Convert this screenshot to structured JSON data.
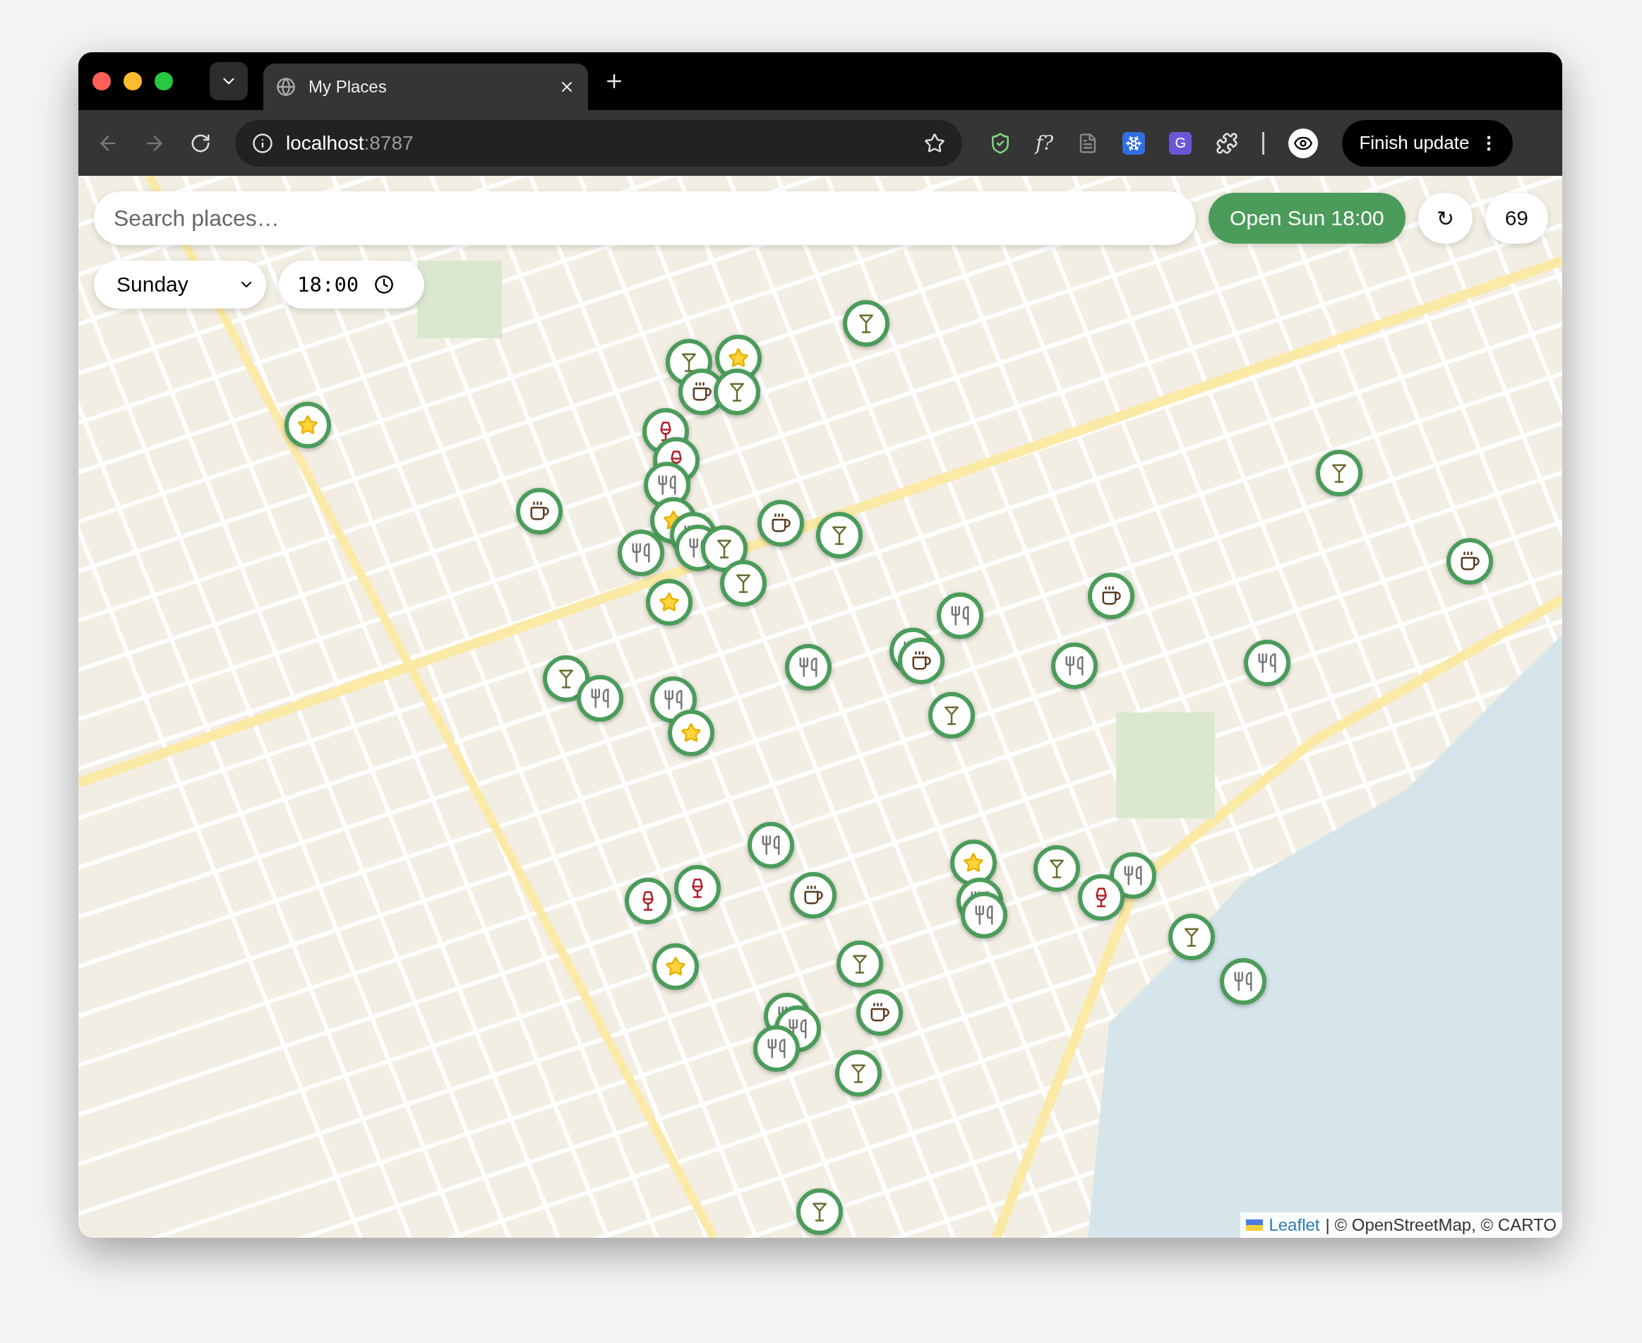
{
  "browser": {
    "tab": {
      "title": "My Places"
    },
    "address": {
      "host": "localhost",
      "port": ":8787"
    },
    "extensions": [
      {
        "kind": "shield"
      },
      {
        "kind": "formula",
        "label": "f?"
      },
      {
        "kind": "document"
      },
      {
        "kind": "snowflake"
      },
      {
        "kind": "letter",
        "label": "G"
      },
      {
        "kind": "puzzle"
      }
    ],
    "update_button": "Finish update"
  },
  "controls": {
    "search": {
      "placeholder": "Search places…"
    },
    "open_filter": "Open Sun 18:00",
    "refresh": "↻",
    "count": "69",
    "day": "Sunday",
    "time": "18:00"
  },
  "markers": [
    {
      "kind": "cocktail"
    },
    {
      "kind": "star"
    },
    {
      "kind": "cocktail"
    },
    {
      "kind": "star"
    },
    {
      "kind": "coffee"
    },
    {
      "kind": "cocktail"
    },
    {
      "kind": "wine"
    },
    {
      "kind": "wine"
    },
    {
      "kind": "dining"
    },
    {
      "kind": "star"
    },
    {
      "kind": "dining"
    },
    {
      "kind": "dining"
    },
    {
      "kind": "dining"
    },
    {
      "kind": "cocktail"
    },
    {
      "kind": "cocktail"
    },
    {
      "kind": "star"
    },
    {
      "kind": "coffee"
    },
    {
      "kind": "coffee"
    },
    {
      "kind": "cocktail"
    },
    {
      "kind": "cocktail"
    },
    {
      "kind": "coffee"
    },
    {
      "kind": "coffee"
    },
    {
      "kind": "dining"
    },
    {
      "kind": "dining"
    },
    {
      "kind": "coffee"
    },
    {
      "kind": "dining"
    },
    {
      "kind": "dining"
    },
    {
      "kind": "dining"
    },
    {
      "kind": "cocktail"
    },
    {
      "kind": "cocktail"
    },
    {
      "kind": "dining"
    },
    {
      "kind": "dining"
    },
    {
      "kind": "star"
    },
    {
      "kind": "dining"
    },
    {
      "kind": "star"
    },
    {
      "kind": "cocktail"
    },
    {
      "kind": "dining"
    },
    {
      "kind": "wine"
    },
    {
      "kind": "dining"
    },
    {
      "kind": "dining"
    },
    {
      "kind": "wine"
    },
    {
      "kind": "wine"
    },
    {
      "kind": "coffee"
    },
    {
      "kind": "cocktail"
    },
    {
      "kind": "cocktail"
    },
    {
      "kind": "star"
    },
    {
      "kind": "dining"
    },
    {
      "kind": "coffee"
    },
    {
      "kind": "dining"
    },
    {
      "kind": "dining"
    },
    {
      "kind": "dining"
    },
    {
      "kind": "cocktail"
    },
    {
      "kind": "cocktail"
    }
  ],
  "attribution": {
    "link": "Leaflet",
    "text": "| © OpenStreetMap, © CARTO"
  }
}
